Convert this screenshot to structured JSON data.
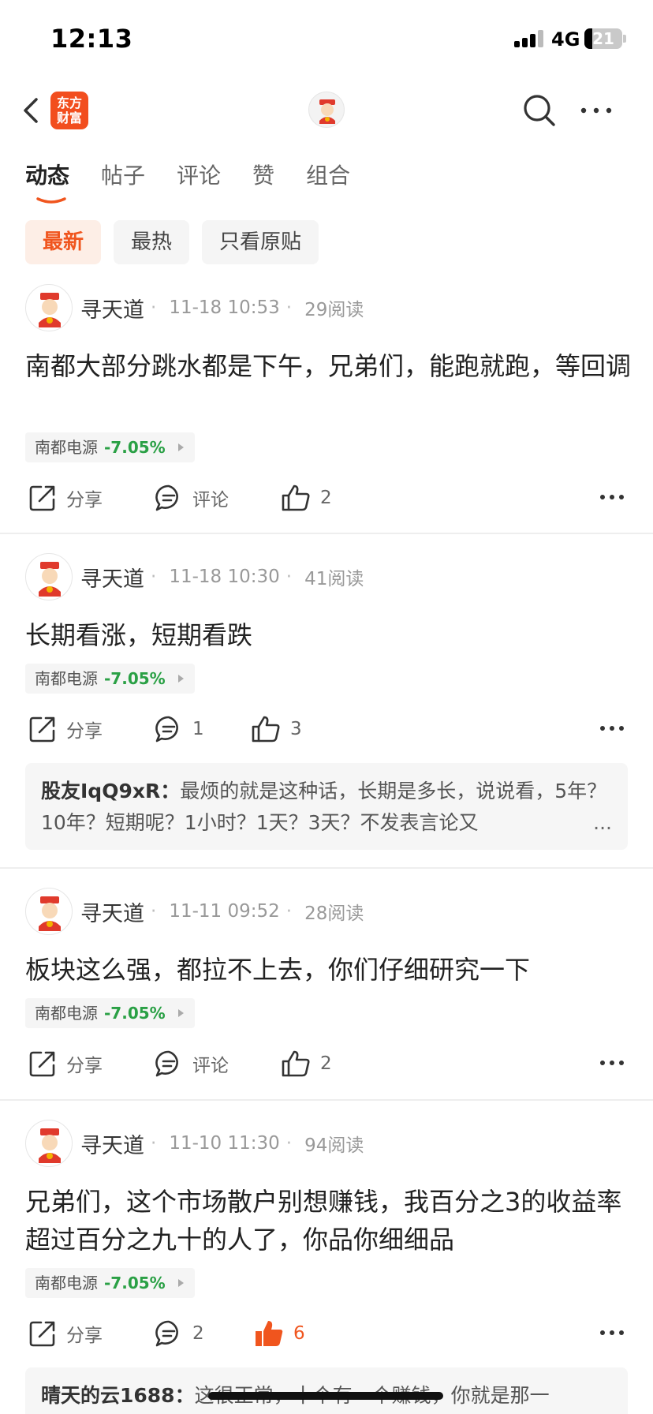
{
  "status_bar": {
    "time": "12:13",
    "network": "4G",
    "battery": "21"
  },
  "nav": {
    "logo_text_line1": "东方",
    "logo_text_line2": "财富"
  },
  "tabs": [
    {
      "label": "动态"
    },
    {
      "label": "帖子"
    },
    {
      "label": "评论"
    },
    {
      "label": "赞"
    },
    {
      "label": "组合"
    }
  ],
  "filters": [
    {
      "label": "最新"
    },
    {
      "label": "最热"
    },
    {
      "label": "只看原贴"
    }
  ],
  "share_label": "分享",
  "comment_label": "评论",
  "posts": [
    {
      "author": "寻天道",
      "time": "11-18 10:53",
      "reads": "29阅读",
      "text": "南都大部分跳水都是下午，兄弟们，能跑就跑，等回调",
      "stock": "南都电源",
      "change": "-7.05%",
      "comments": "评论",
      "likes": "2"
    },
    {
      "author": "寻天道",
      "time": "11-18 10:30",
      "reads": "41阅读",
      "text": "长期看涨，短期看跌",
      "stock": "南都电源",
      "change": "-7.05%",
      "comments": "1",
      "likes": "3",
      "top_comment": {
        "user": "股友IqQ9xR：",
        "text": "最烦的就是这种话，长期是多长，说说看，5年？10年？短期呢？1小时？1天？3天？不发表言论又",
        "ellipsis": "..."
      }
    },
    {
      "author": "寻天道",
      "time": "11-11 09:52",
      "reads": "28阅读",
      "text": "板块这么强，都拉不上去，你们仔细研究一下",
      "stock": "南都电源",
      "change": "-7.05%",
      "comments": "评论",
      "likes": "2"
    },
    {
      "author": "寻天道",
      "time": "11-10 11:30",
      "reads": "94阅读",
      "text": "兄弟们，这个市场散户别想赚钱，我百分之3的收益率超过百分之九十的人了，你品你细细品",
      "stock": "南都电源",
      "change": "-7.05%",
      "comments": "2",
      "likes": "6",
      "top_comment": {
        "user": "晴天的云1688：",
        "text": "这很正常，十个有一个赚钱，你就是那一"
      }
    }
  ],
  "colors": {
    "accent": "#f0551e",
    "down": "#2aa045",
    "logo": "#f24e1e"
  }
}
